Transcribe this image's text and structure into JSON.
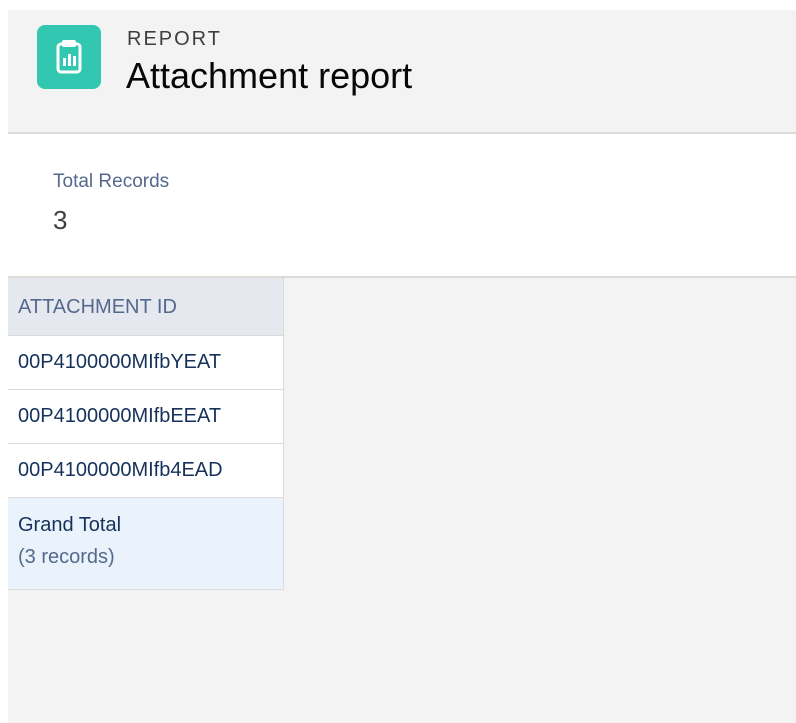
{
  "header": {
    "eyebrow": "REPORT",
    "title": "Attachment report",
    "icon": "report-icon",
    "icon_bg": "#32c7b1"
  },
  "summary": {
    "label": "Total Records",
    "value": "3"
  },
  "table": {
    "columns": [
      "ATTACHMENT ID"
    ],
    "rows": [
      [
        "00P4100000MIfbYEAT"
      ],
      [
        "00P4100000MIfbEEAT"
      ],
      [
        "00P4100000MIfb4EAD"
      ]
    ],
    "grand_total": {
      "label": "Grand Total",
      "count": "(3 records)"
    }
  },
  "colors": {
    "header_bg": "#f3f3f3",
    "table_header_bg": "#e5e8ee",
    "grand_total_bg": "#eaf3fb",
    "text_primary": "#16325c",
    "text_muted": "#54698d"
  }
}
